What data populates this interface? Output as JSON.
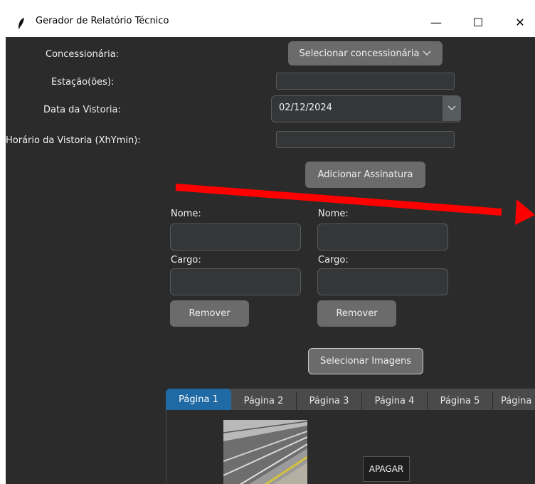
{
  "window": {
    "title": "Gerador de Relatório Técnico",
    "minimize_glyph": "—",
    "maximize_glyph": "☐",
    "close_glyph": "✕"
  },
  "form": {
    "concessionaria_label": "Concessionária:",
    "concessionaria_value": "Selecionar concessionária",
    "estacoes_label": "Estação(ões):",
    "estacoes_value": "",
    "data_label": "Data da Vistoria:",
    "data_value": "02/12/2024",
    "horario_label": "Horário da Vistoria (XhYmin):",
    "horario_value": ""
  },
  "signatures": {
    "add_button": "Adicionar Assinatura",
    "items": [
      {
        "nome_label": "Nome:",
        "nome_value": "",
        "cargo_label": "Cargo:",
        "cargo_value": "",
        "remove_label": "Remover"
      },
      {
        "nome_label": "Nome:",
        "nome_value": "",
        "cargo_label": "Cargo:",
        "cargo_value": "",
        "remove_label": "Remover"
      }
    ]
  },
  "images": {
    "select_button": "Selecionar Imagens",
    "tabs": [
      "Página 1",
      "Página 2",
      "Página 3",
      "Página 4",
      "Página 5",
      "Página"
    ],
    "active_tab": 0,
    "delete_button": "APAGAR"
  },
  "colors": {
    "background": "#2b2b2b",
    "accent_tab": "#1f6aa5",
    "annotation_arrow": "#ff0000"
  },
  "icons": {
    "app": "feather-icon",
    "dropdown": "chevron-down-icon"
  }
}
